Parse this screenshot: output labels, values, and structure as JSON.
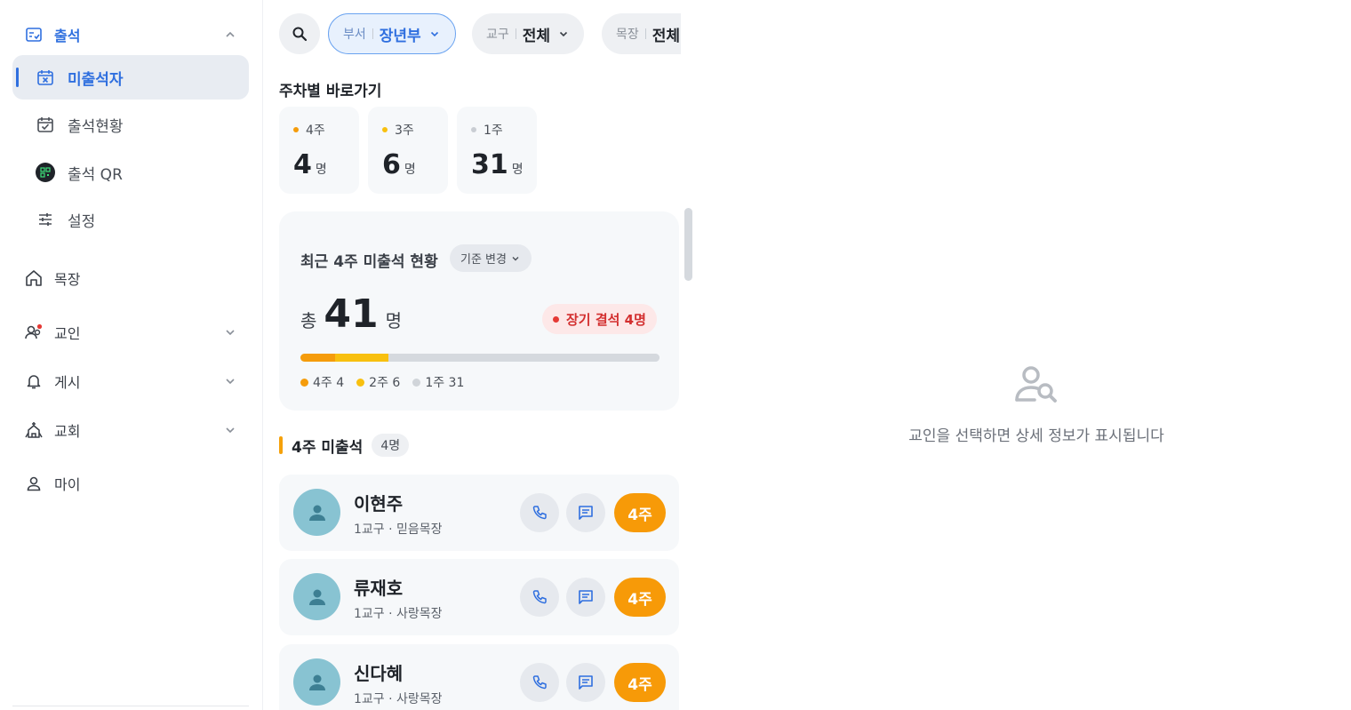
{
  "sidebar": {
    "attendance": {
      "label": "출석"
    },
    "absentees": {
      "label": "미출석자"
    },
    "status": {
      "label": "출석현황"
    },
    "qr": {
      "label": "출석 QR"
    },
    "settings": {
      "label": "설정"
    },
    "cell": {
      "label": "목장"
    },
    "members": {
      "label": "교인"
    },
    "board": {
      "label": "게시"
    },
    "church": {
      "label": "교회"
    },
    "my": {
      "label": "마이"
    }
  },
  "filters": [
    {
      "key": "부서",
      "value": "장년부",
      "active": true
    },
    {
      "key": "교구",
      "value": "전체",
      "active": false
    },
    {
      "key": "목장",
      "value": "전체",
      "active": false
    }
  ],
  "weekly": {
    "title": "주차별 바로가기",
    "unit": "명",
    "cards": [
      {
        "label": "4주",
        "count": "4",
        "color": "#f59c0b"
      },
      {
        "label": "3주",
        "count": "6",
        "color": "#f8c00f"
      },
      {
        "label": "1주",
        "count": "31",
        "color": "#c9cdd3"
      }
    ]
  },
  "summary": {
    "title": "최근 4주 미출석 현황",
    "criteria_label": "기준 변경",
    "total_prefix": "총",
    "total": "41",
    "total_unit": "명",
    "alert": "장기 결석 4명",
    "progress": [
      {
        "label": "4주 4",
        "value": 4,
        "color": "#f59c0b"
      },
      {
        "label": "2주 6",
        "value": 6,
        "color": "#f8c00f"
      },
      {
        "label": "1주 31",
        "value": 31,
        "color": "#d5d9de"
      }
    ],
    "progress_total": 41
  },
  "list": {
    "title": "4주 미출석",
    "count": "4명",
    "people": [
      {
        "name": "이현주",
        "sub": "1교구 · 믿음목장",
        "badge": "4주"
      },
      {
        "name": "류재호",
        "sub": "1교구 · 사랑목장",
        "badge": "4주"
      },
      {
        "name": "신다혜",
        "sub": "1교구 · 사랑목장",
        "badge": "4주"
      }
    ]
  },
  "detail": {
    "empty_message": "교인을 선택하면 상세 정보가 표시됩니다"
  },
  "colors": {
    "accent": "#2f6fdf",
    "orange": "#f79a08",
    "alert": "#e53935"
  }
}
